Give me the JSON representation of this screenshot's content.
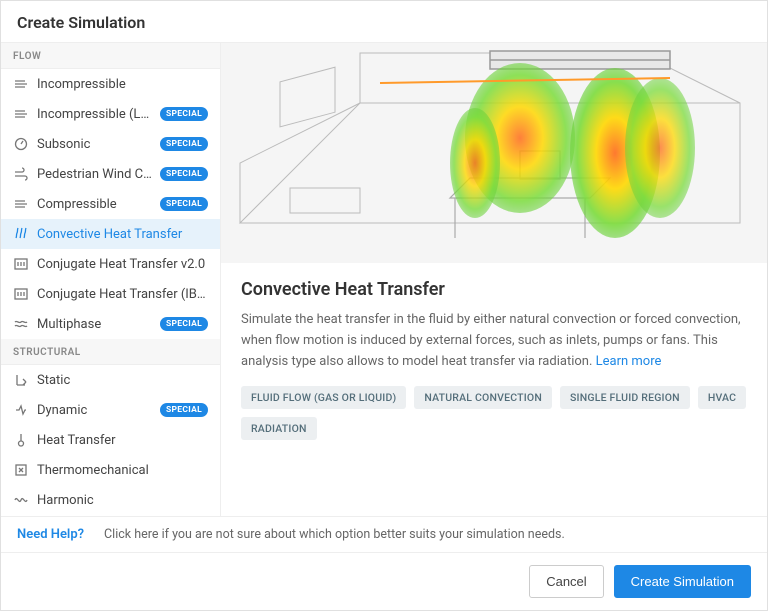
{
  "header": {
    "title": "Create Simulation"
  },
  "sidebar": {
    "sections": [
      {
        "header": "FLOW",
        "items": [
          {
            "label": "Incompressible",
            "special": false
          },
          {
            "label": "Incompressible (LBM)",
            "special": true
          },
          {
            "label": "Subsonic",
            "special": true
          },
          {
            "label": "Pedestrian Wind Com…",
            "special": true
          },
          {
            "label": "Compressible",
            "special": true
          },
          {
            "label": "Convective Heat Transfer",
            "special": false,
            "selected": true
          },
          {
            "label": "Conjugate Heat Transfer v2.0",
            "special": false
          },
          {
            "label": "Conjugate Heat Transfer (IBM)",
            "special": false
          },
          {
            "label": "Multiphase",
            "special": true
          }
        ]
      },
      {
        "header": "STRUCTURAL",
        "items": [
          {
            "label": "Static",
            "special": false
          },
          {
            "label": "Dynamic",
            "special": true
          },
          {
            "label": "Heat Transfer",
            "special": false
          },
          {
            "label": "Thermomechanical",
            "special": false
          },
          {
            "label": "Harmonic",
            "special": false
          }
        ]
      }
    ],
    "special_badge": "SPECIAL"
  },
  "detail": {
    "title": "Convective Heat Transfer",
    "description": "Simulate the heat transfer in the fluid by either natural convection or forced convection, when flow motion is induced by external forces, such as inlets, pumps or fans. This analysis type also allows to model heat transfer via radiation. ",
    "learn_more": "Learn more",
    "tags": [
      "FLUID FLOW (GAS OR LIQUID)",
      "NATURAL CONVECTION",
      "SINGLE FLUID REGION",
      "HVAC",
      "RADIATION"
    ]
  },
  "help": {
    "link": "Need Help?",
    "text": "Click here if you are not sure about which option better suits your simulation needs."
  },
  "footer": {
    "cancel": "Cancel",
    "create": "Create Simulation"
  }
}
